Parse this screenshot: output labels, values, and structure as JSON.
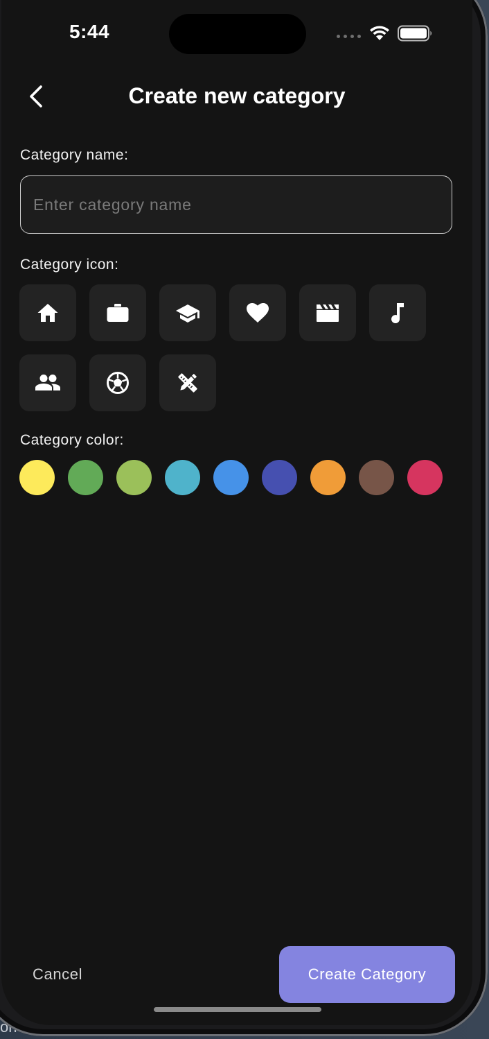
{
  "status_bar": {
    "time": "5:44"
  },
  "header": {
    "title": "Create new category"
  },
  "name_field": {
    "label": "Category name:",
    "placeholder": "Enter category name",
    "value": ""
  },
  "icon_section": {
    "label": "Category icon:",
    "icons": [
      "home-icon",
      "briefcase-icon",
      "graduation-cap-icon",
      "heart-icon",
      "clapperboard-icon",
      "music-note-icon",
      "people-icon",
      "soccer-ball-icon",
      "design-tools-icon"
    ]
  },
  "color_section": {
    "label": "Category color:",
    "colors": [
      "#fdea5b",
      "#62aa57",
      "#9bc05a",
      "#4fb3cb",
      "#4692e8",
      "#4650b0",
      "#f09c38",
      "#775548",
      "#d6355f"
    ]
  },
  "footer": {
    "cancel_label": "Cancel",
    "create_label": "Create Category"
  },
  "desktop": {
    "partial_text": "one"
  }
}
